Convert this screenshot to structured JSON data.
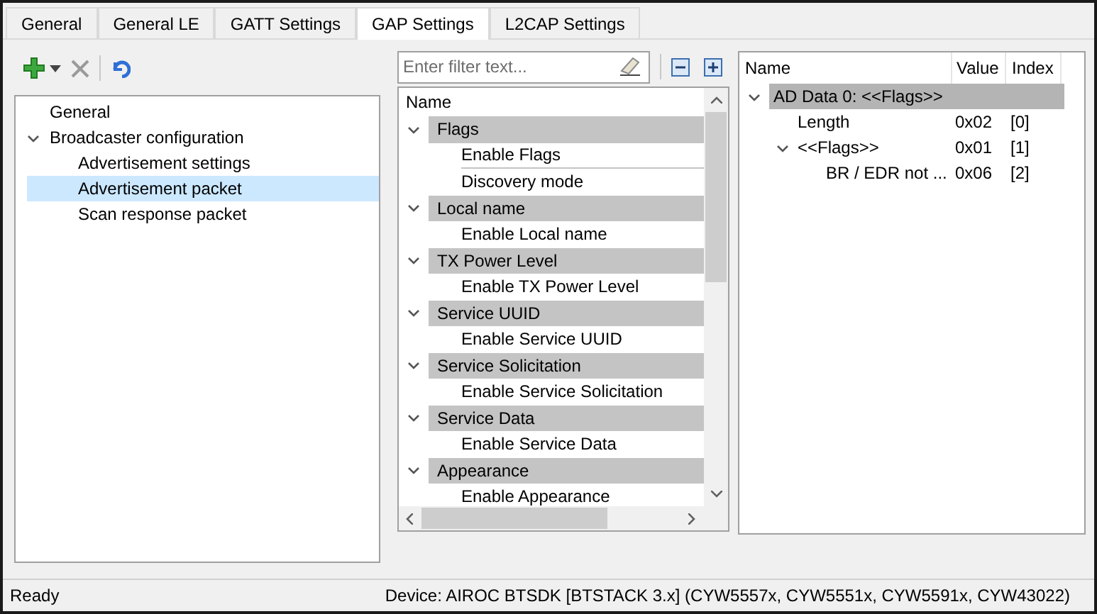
{
  "tabs": [
    {
      "label": "General",
      "selected": false
    },
    {
      "label": "General LE",
      "selected": false
    },
    {
      "label": "GATT Settings",
      "selected": false
    },
    {
      "label": "GAP Settings",
      "selected": true
    },
    {
      "label": "L2CAP Settings",
      "selected": false
    }
  ],
  "config_tree": [
    {
      "label": "General"
    },
    {
      "label": "Broadcaster configuration",
      "expanded": true,
      "children": [
        {
          "label": "Advertisement settings",
          "selected": false
        },
        {
          "label": "Advertisement packet",
          "selected": true
        },
        {
          "label": "Scan response packet",
          "selected": false
        }
      ]
    }
  ],
  "filter": {
    "placeholder": "Enter filter text..."
  },
  "field_tree": {
    "column": "Name",
    "groups": [
      {
        "label": "Flags",
        "expanded": true,
        "children": [
          "Enable Flags",
          "Discovery mode"
        ]
      },
      {
        "label": "Local name",
        "expanded": true,
        "children": [
          "Enable Local name"
        ]
      },
      {
        "label": "TX Power Level",
        "expanded": true,
        "children": [
          "Enable TX Power Level"
        ]
      },
      {
        "label": "Service UUID",
        "expanded": true,
        "children": [
          "Enable Service UUID"
        ]
      },
      {
        "label": "Service Solicitation",
        "expanded": true,
        "children": [
          "Enable Service Solicitation"
        ]
      },
      {
        "label": "Service Data",
        "expanded": true,
        "children": [
          "Enable Service Data"
        ]
      },
      {
        "label": "Appearance",
        "expanded": true,
        "children": [
          "Enable Appearance"
        ]
      }
    ]
  },
  "packet_table": {
    "columns": [
      "Name",
      "Value",
      "Index"
    ],
    "rows": [
      {
        "name": "AD Data 0: <<Flags>>",
        "expanded": true,
        "children": [
          {
            "name": "Length",
            "value": "0x02",
            "index": "[0]"
          },
          {
            "name": "<<Flags>>",
            "value": "0x01",
            "index": "[1]",
            "expanded": true,
            "children": [
              {
                "name": "BR / EDR not ...",
                "value": "0x06",
                "index": "[2]"
              }
            ]
          }
        ]
      }
    ]
  },
  "status_bar": {
    "left": "Ready",
    "right": "Device: AIROC BTSDK [BTSTACK 3.x] (CYW5557x, CYW5551x, CYW5591x, CYW43022)"
  }
}
